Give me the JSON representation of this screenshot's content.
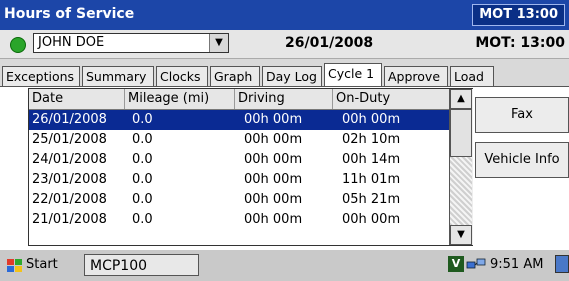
{
  "window": {
    "title": "Hours of Service",
    "mot_badge": "MOT 13:00"
  },
  "driver_bar": {
    "driver": "JOHN DOE",
    "date": "26/01/2008",
    "mot": "MOT: 13:00",
    "status_color": "#2aa52a"
  },
  "tabs": [
    {
      "label": "Exceptions"
    },
    {
      "label": "Summary"
    },
    {
      "label": "Clocks"
    },
    {
      "label": "Graph"
    },
    {
      "label": "Day Log"
    },
    {
      "label": "Cycle 1",
      "active": true
    },
    {
      "label": "Approve"
    },
    {
      "label": "Load"
    }
  ],
  "table": {
    "columns": [
      "Date",
      "Mileage (mi)",
      "Driving",
      "On-Duty"
    ],
    "rows": [
      [
        "26/01/2008",
        "0.0",
        "00h 00m",
        "00h 00m"
      ],
      [
        "25/01/2008",
        "0.0",
        "00h 00m",
        "02h 10m"
      ],
      [
        "24/01/2008",
        "0.0",
        "00h 00m",
        "00h 14m"
      ],
      [
        "23/01/2008",
        "0.0",
        "00h 00m",
        "11h 01m"
      ],
      [
        "22/01/2008",
        "0.0",
        "00h 00m",
        "05h 21m"
      ],
      [
        "21/01/2008",
        "0.0",
        "00h 00m",
        "00h 00m"
      ]
    ],
    "selected_row": 0
  },
  "side_buttons": {
    "fax": "Fax",
    "vehicle_info": "Vehicle Info"
  },
  "taskbar": {
    "start": "Start",
    "task": "MCP100",
    "tray_v": "V",
    "clock": "9:51 AM"
  }
}
